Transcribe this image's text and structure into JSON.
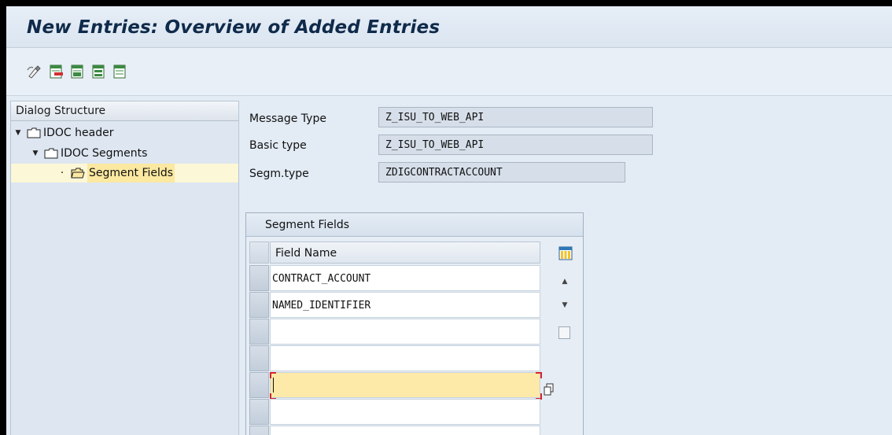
{
  "window": {
    "title": "New Entries: Overview of Added Entries"
  },
  "toolbar": {
    "buttons": [
      {
        "icon": "change-display-icon"
      },
      {
        "icon": "delete-row-icon"
      },
      {
        "icon": "copy-as-icon"
      },
      {
        "icon": "select-all-icon"
      },
      {
        "icon": "deselect-all-icon"
      }
    ]
  },
  "dialog_structure": {
    "title": "Dialog Structure",
    "items": [
      {
        "label": "IDOC header",
        "expanded": true,
        "level": 0
      },
      {
        "label": "IDOC Segments",
        "expanded": true,
        "level": 1
      },
      {
        "label": "Segment Fields",
        "selected": true,
        "level": 2
      }
    ]
  },
  "header_fields": {
    "message_type": {
      "label": "Message Type",
      "value": "Z_ISU_TO_WEB_API"
    },
    "basic_type": {
      "label": "Basic type",
      "value": "Z_ISU_TO_WEB_API"
    },
    "segm_type": {
      "label": "Segm.type",
      "value": "ZDIGCONTRACTACCOUNT"
    }
  },
  "segment_table": {
    "title": "Segment Fields",
    "column_header": "Field Name",
    "rows": [
      "CONTRACT_ACCOUNT",
      "NAMED_IDENTIFIER",
      "",
      "",
      "",
      "",
      ""
    ]
  },
  "colors": {
    "background": "#e3ebf4",
    "title_text": "#0f2a4a",
    "selected_tree_item": "#fbe8a1",
    "active_cell": "#fde9a8",
    "focus_corner": "#d2262b"
  }
}
